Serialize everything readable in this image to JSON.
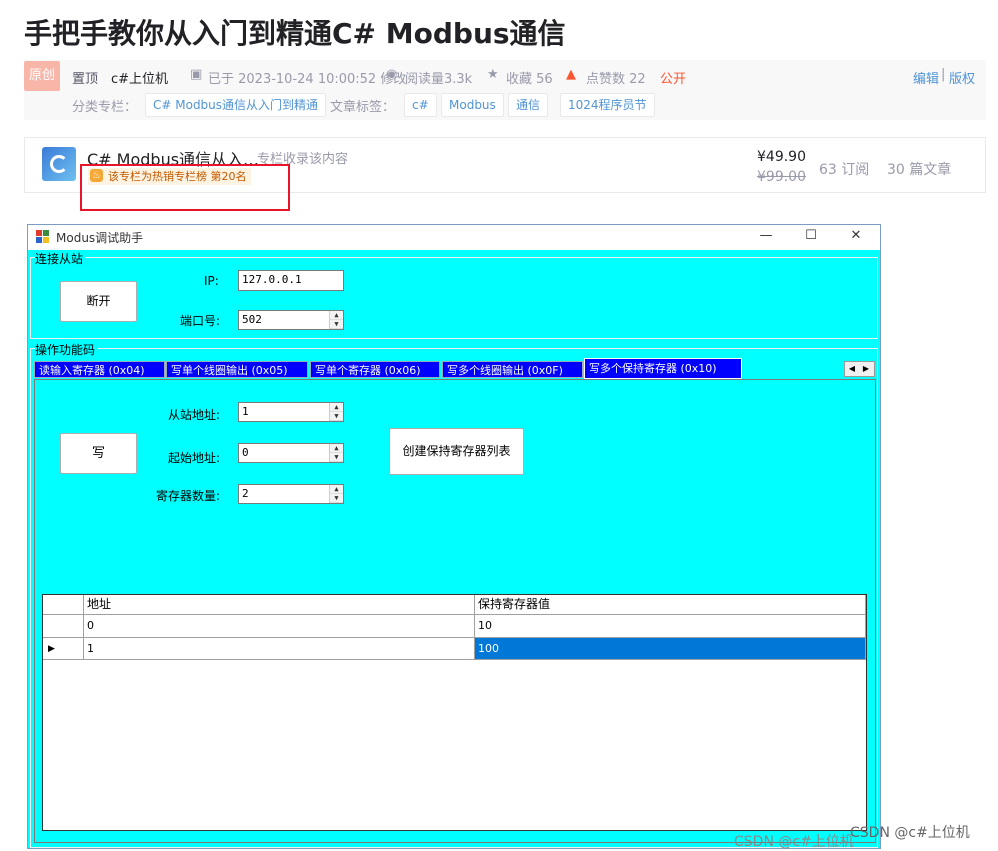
{
  "article": {
    "title": "手把手教你从入门到精通C# Modbus通信",
    "badge": "原创",
    "pinned": "置顶",
    "author": "c#上位机",
    "modified": "已于 2023-10-24 10:00:52 修改",
    "reads": "阅读量3.3k",
    "favorites": "收藏 56",
    "likes": "点赞数 22",
    "visibility": "公开",
    "edit": "编辑",
    "copyright": "版权",
    "column_label": "分类专栏：",
    "column_tag": "C# Modbus通信从入门到精通",
    "tags_label": "文章标签：",
    "tags": [
      "c#",
      "Modbus",
      "通信",
      "1024程序员节"
    ]
  },
  "column_card": {
    "name": "C# Modbus通信从入…",
    "collect": "专栏收录该内容",
    "hot": "该专栏为热销专栏榜 第20名",
    "price_now": "¥49.90",
    "price_old": "¥99.00",
    "subscriptions": "63 订阅",
    "articles": "30 篇文章"
  },
  "window": {
    "title": "Modus调试助手",
    "connect_group": "连接从站",
    "disconnect_btn": "断开",
    "ip_label": "IP:",
    "ip_value": "127.0.0.1",
    "port_label": "端口号:",
    "port_value": "502",
    "ops_group": "操作功能码",
    "tabs": [
      "读输入寄存器 (0x04)",
      "写单个线圈输出 (0x05)",
      "写单个寄存器 (0x06)",
      "写多个线圈输出 (0x0F)",
      "写多个保持寄存器 (0x10)"
    ],
    "write_btn": "写",
    "slave_label": "从站地址:",
    "slave_value": "1",
    "start_label": "起始地址:",
    "start_value": "0",
    "count_label": "寄存器数量:",
    "count_value": "2",
    "create_btn": "创建保持寄存器列表",
    "grid": {
      "headers": [
        "地址",
        "保持寄存器值"
      ],
      "rows": [
        [
          "0",
          "10"
        ],
        [
          "1",
          "100"
        ]
      ]
    }
  },
  "watermark": {
    "a": "CSDN @c#上位机",
    "b": "CSDN @c#上位机"
  }
}
